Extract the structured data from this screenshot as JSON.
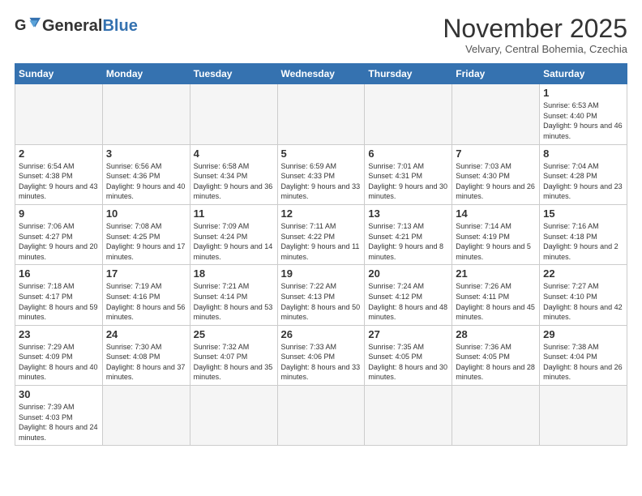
{
  "header": {
    "logo_general": "General",
    "logo_blue": "Blue",
    "month_title": "November 2025",
    "subtitle": "Velvary, Central Bohemia, Czechia"
  },
  "days_of_week": [
    "Sunday",
    "Monday",
    "Tuesday",
    "Wednesday",
    "Thursday",
    "Friday",
    "Saturday"
  ],
  "weeks": [
    [
      {
        "day": "",
        "info": ""
      },
      {
        "day": "",
        "info": ""
      },
      {
        "day": "",
        "info": ""
      },
      {
        "day": "",
        "info": ""
      },
      {
        "day": "",
        "info": ""
      },
      {
        "day": "",
        "info": ""
      },
      {
        "day": "1",
        "info": "Sunrise: 6:53 AM\nSunset: 4:40 PM\nDaylight: 9 hours\nand 46 minutes."
      }
    ],
    [
      {
        "day": "2",
        "info": "Sunrise: 6:54 AM\nSunset: 4:38 PM\nDaylight: 9 hours\nand 43 minutes."
      },
      {
        "day": "3",
        "info": "Sunrise: 6:56 AM\nSunset: 4:36 PM\nDaylight: 9 hours\nand 40 minutes."
      },
      {
        "day": "4",
        "info": "Sunrise: 6:58 AM\nSunset: 4:34 PM\nDaylight: 9 hours\nand 36 minutes."
      },
      {
        "day": "5",
        "info": "Sunrise: 6:59 AM\nSunset: 4:33 PM\nDaylight: 9 hours\nand 33 minutes."
      },
      {
        "day": "6",
        "info": "Sunrise: 7:01 AM\nSunset: 4:31 PM\nDaylight: 9 hours\nand 30 minutes."
      },
      {
        "day": "7",
        "info": "Sunrise: 7:03 AM\nSunset: 4:30 PM\nDaylight: 9 hours\nand 26 minutes."
      },
      {
        "day": "8",
        "info": "Sunrise: 7:04 AM\nSunset: 4:28 PM\nDaylight: 9 hours\nand 23 minutes."
      }
    ],
    [
      {
        "day": "9",
        "info": "Sunrise: 7:06 AM\nSunset: 4:27 PM\nDaylight: 9 hours\nand 20 minutes."
      },
      {
        "day": "10",
        "info": "Sunrise: 7:08 AM\nSunset: 4:25 PM\nDaylight: 9 hours\nand 17 minutes."
      },
      {
        "day": "11",
        "info": "Sunrise: 7:09 AM\nSunset: 4:24 PM\nDaylight: 9 hours\nand 14 minutes."
      },
      {
        "day": "12",
        "info": "Sunrise: 7:11 AM\nSunset: 4:22 PM\nDaylight: 9 hours\nand 11 minutes."
      },
      {
        "day": "13",
        "info": "Sunrise: 7:13 AM\nSunset: 4:21 PM\nDaylight: 9 hours\nand 8 minutes."
      },
      {
        "day": "14",
        "info": "Sunrise: 7:14 AM\nSunset: 4:19 PM\nDaylight: 9 hours\nand 5 minutes."
      },
      {
        "day": "15",
        "info": "Sunrise: 7:16 AM\nSunset: 4:18 PM\nDaylight: 9 hours\nand 2 minutes."
      }
    ],
    [
      {
        "day": "16",
        "info": "Sunrise: 7:18 AM\nSunset: 4:17 PM\nDaylight: 8 hours\nand 59 minutes."
      },
      {
        "day": "17",
        "info": "Sunrise: 7:19 AM\nSunset: 4:16 PM\nDaylight: 8 hours\nand 56 minutes."
      },
      {
        "day": "18",
        "info": "Sunrise: 7:21 AM\nSunset: 4:14 PM\nDaylight: 8 hours\nand 53 minutes."
      },
      {
        "day": "19",
        "info": "Sunrise: 7:22 AM\nSunset: 4:13 PM\nDaylight: 8 hours\nand 50 minutes."
      },
      {
        "day": "20",
        "info": "Sunrise: 7:24 AM\nSunset: 4:12 PM\nDaylight: 8 hours\nand 48 minutes."
      },
      {
        "day": "21",
        "info": "Sunrise: 7:26 AM\nSunset: 4:11 PM\nDaylight: 8 hours\nand 45 minutes."
      },
      {
        "day": "22",
        "info": "Sunrise: 7:27 AM\nSunset: 4:10 PM\nDaylight: 8 hours\nand 42 minutes."
      }
    ],
    [
      {
        "day": "23",
        "info": "Sunrise: 7:29 AM\nSunset: 4:09 PM\nDaylight: 8 hours\nand 40 minutes."
      },
      {
        "day": "24",
        "info": "Sunrise: 7:30 AM\nSunset: 4:08 PM\nDaylight: 8 hours\nand 37 minutes."
      },
      {
        "day": "25",
        "info": "Sunrise: 7:32 AM\nSunset: 4:07 PM\nDaylight: 8 hours\nand 35 minutes."
      },
      {
        "day": "26",
        "info": "Sunrise: 7:33 AM\nSunset: 4:06 PM\nDaylight: 8 hours\nand 33 minutes."
      },
      {
        "day": "27",
        "info": "Sunrise: 7:35 AM\nSunset: 4:05 PM\nDaylight: 8 hours\nand 30 minutes."
      },
      {
        "day": "28",
        "info": "Sunrise: 7:36 AM\nSunset: 4:05 PM\nDaylight: 8 hours\nand 28 minutes."
      },
      {
        "day": "29",
        "info": "Sunrise: 7:38 AM\nSunset: 4:04 PM\nDaylight: 8 hours\nand 26 minutes."
      }
    ],
    [
      {
        "day": "30",
        "info": "Sunrise: 7:39 AM\nSunset: 4:03 PM\nDaylight: 8 hours\nand 24 minutes."
      },
      {
        "day": "",
        "info": ""
      },
      {
        "day": "",
        "info": ""
      },
      {
        "day": "",
        "info": ""
      },
      {
        "day": "",
        "info": ""
      },
      {
        "day": "",
        "info": ""
      },
      {
        "day": "",
        "info": ""
      }
    ]
  ]
}
